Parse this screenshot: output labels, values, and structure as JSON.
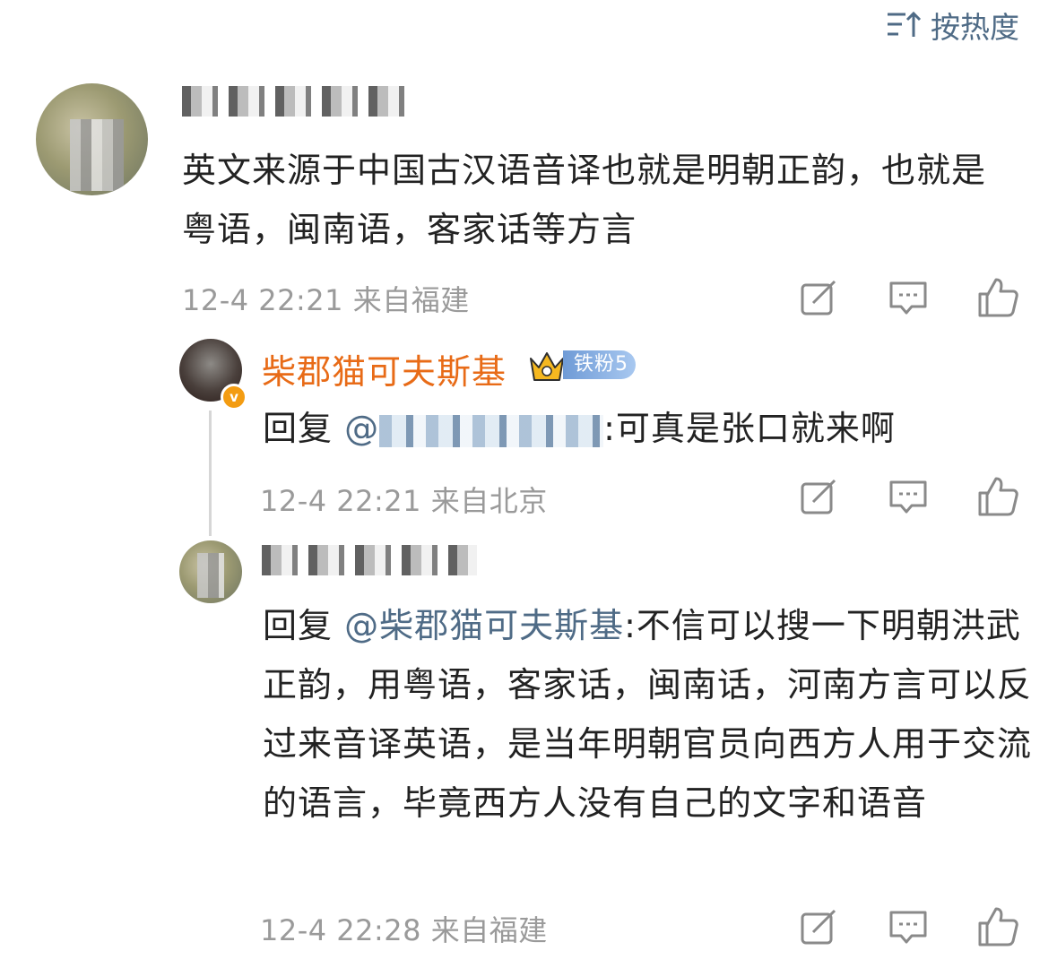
{
  "sort": {
    "label": "按热度",
    "icon": "sort-icon"
  },
  "comments": [
    {
      "text": "英文来源于中国古汉语音译也就是明朝正韵，也就是粤语，闽南语，客家话等方言",
      "time": "12-4 22:21",
      "location": "来自福建"
    }
  ],
  "replies": [
    {
      "author": "柴郡猫可夫斯基",
      "fan_badge": "铁粉5",
      "reply_prefix": "回复",
      "mention": "@",
      "text": ":可真是张口就来啊",
      "time": "12-4 22:21",
      "location": "来自北京"
    },
    {
      "reply_prefix": "回复",
      "mention": "@柴郡猫可夫斯基",
      "text": ":不信可以搜一下明朝洪武正韵，用粤语，客家话，闽南话，河南方言可以反过来音译英语，是当年明朝官员向西方人用于交流的语言，毕竟西方人没有自己的文字和语音",
      "time": "12-4 22:28",
      "location": "来自福建"
    }
  ],
  "colors": {
    "mention": "#4f6b86",
    "vip_name": "#e86b17",
    "meta": "#9a9a9a",
    "text": "#222222"
  }
}
